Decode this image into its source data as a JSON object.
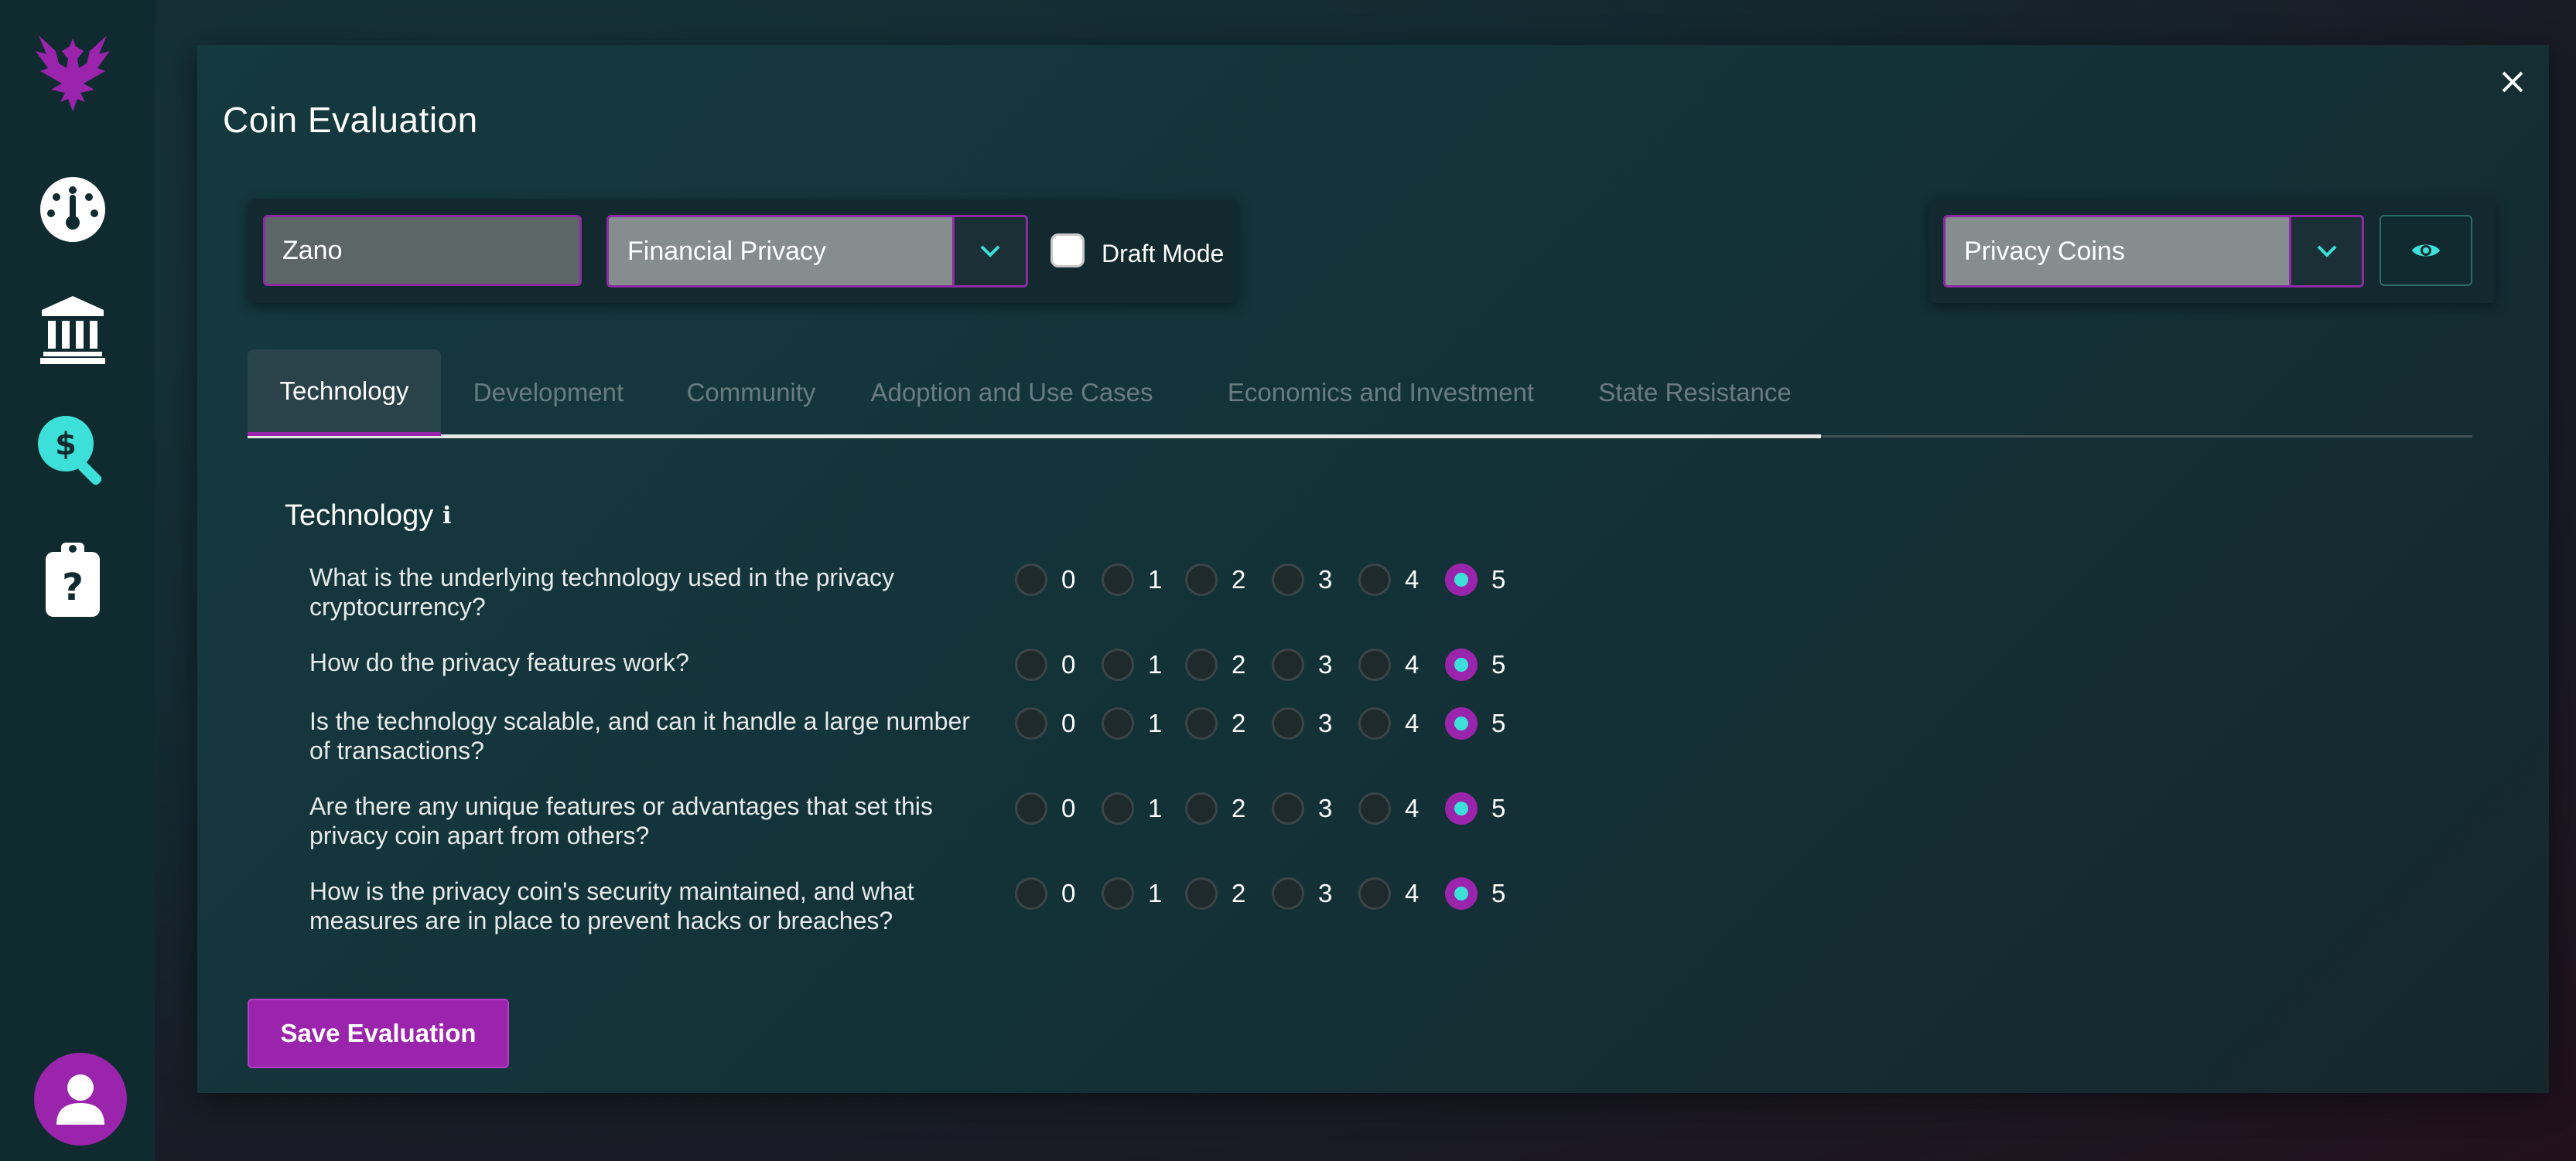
{
  "theme": {
    "accent": "#9b24ac",
    "teal": "#3de0d8",
    "background": "#132a31"
  },
  "sidebar": {
    "logo": "phoenix-logo",
    "items": [
      {
        "icon": "dashboard-gauge-icon"
      },
      {
        "icon": "bank-icon"
      },
      {
        "icon": "dollar-search-icon",
        "active": true
      },
      {
        "icon": "clipboard-question-icon"
      }
    ],
    "profile_icon": "user-avatar-icon"
  },
  "modal": {
    "title": "Coin Evaluation",
    "coin_input_value": "Zano",
    "category_select_value": "Financial Privacy",
    "draft_mode_label": "Draft Mode",
    "draft_mode_checked": false,
    "list_select_value": "Privacy Coins",
    "tabs": [
      {
        "label": "Technology",
        "active": true
      },
      {
        "label": "Development"
      },
      {
        "label": "Community"
      },
      {
        "label": "Adoption and Use Cases"
      },
      {
        "label": "Economics and Investment"
      },
      {
        "label": "State Resistance"
      }
    ],
    "section": {
      "title": "Technology",
      "info": "i",
      "options": [
        "0",
        "1",
        "2",
        "3",
        "4",
        "5"
      ],
      "questions": [
        {
          "text": "What is the underlying technology used in the privacy cryptocurrency?",
          "selected": 5
        },
        {
          "text": "How do the privacy features work?",
          "selected": 5
        },
        {
          "text": "Is the technology scalable, and can it handle a large number of transactions?",
          "selected": 5
        },
        {
          "text": "Are there any unique features or advantages that set this privacy coin apart from others?",
          "selected": 5
        },
        {
          "text": "How is the privacy coin's security maintained, and what measures are in place to prevent hacks or breaches?",
          "selected": 5
        }
      ]
    },
    "save_label": "Save Evaluation"
  }
}
